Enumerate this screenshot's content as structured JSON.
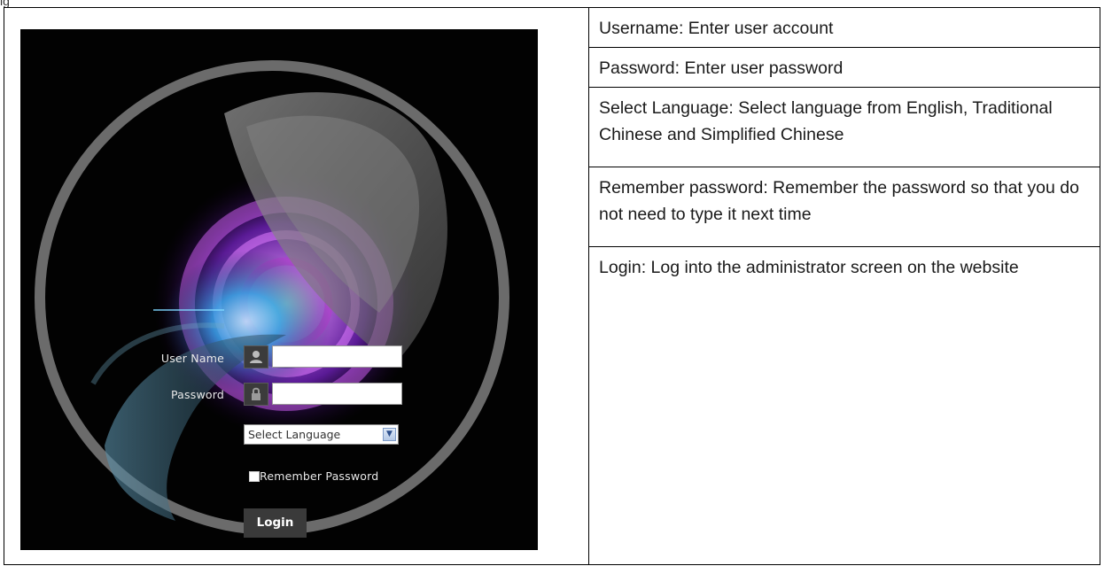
{
  "page": {
    "top_fragment": "ig"
  },
  "login_screen": {
    "username_label": "User Name",
    "password_label": "Password",
    "language_select": "Select Language",
    "remember_label": "Remember Password",
    "login_button": "Login",
    "icons": {
      "user": "user-icon",
      "lock": "lock-icon",
      "dropdown": "chevron-down-icon"
    }
  },
  "descriptions": [
    {
      "text": "Username:  Enter user account"
    },
    {
      "text": "Password: Enter user password"
    },
    {
      "text": "Select Language:  Select language  from English, Traditional  Chinese  and  Simplified Chinese"
    },
    {
      "text": "Remember  password: Remember  the password so that you do not need to type it next time"
    },
    {
      "text": "Login: Log into the administrator screen on the website"
    }
  ],
  "colors": {
    "screen_bg": "#020202",
    "accent_purple": "#b23ad8",
    "accent_blue": "#2aa7e0",
    "ring": "#6b6b6b"
  }
}
